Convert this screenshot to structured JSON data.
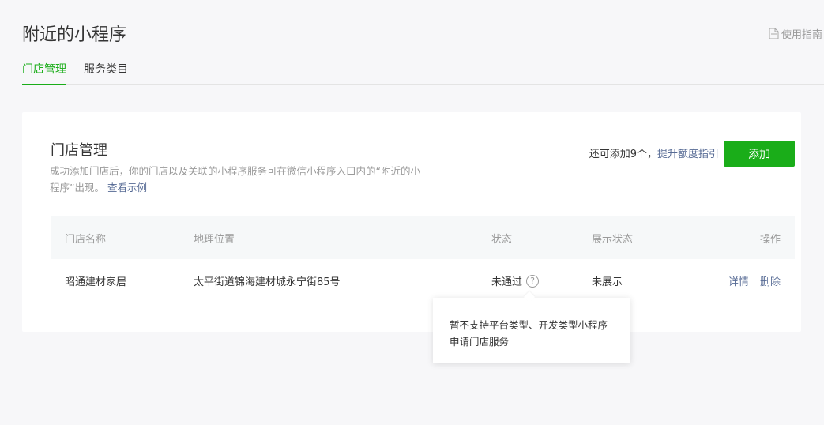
{
  "header": {
    "title": "附近的小程序",
    "guide_label": "使用指南"
  },
  "tabs": [
    {
      "label": "门店管理",
      "active": true
    },
    {
      "label": "服务类目",
      "active": false
    }
  ],
  "card": {
    "title": "门店管理",
    "desc": "成功添加门店后，你的门店以及关联的小程序服务可在微信小程序入口内的“附近的小程序”出现。",
    "example_link": "查看示例",
    "quota_text": "还可添加9个，",
    "quota_link": "提升额度指引",
    "add_label": "添加"
  },
  "table": {
    "columns": [
      "门店名称",
      "地理位置",
      "状态",
      "展示状态",
      "操作"
    ],
    "rows": [
      {
        "name": "昭通建材家居",
        "location": "太平街道锦海建材城永宁街85号",
        "status": "未通过",
        "display_status": "未展示",
        "actions": [
          "详情",
          "删除"
        ]
      }
    ]
  },
  "tooltip": {
    "text": "暂不支持平台类型、开发类型小程序申请门店服务"
  },
  "colors": {
    "accent": "#1aad19",
    "link": "#576b95"
  }
}
